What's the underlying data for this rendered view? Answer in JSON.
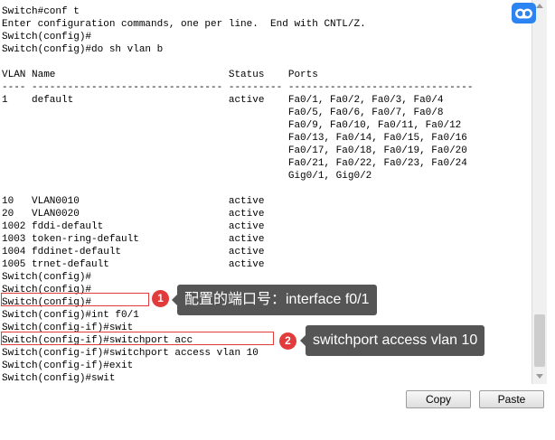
{
  "terminal": {
    "lines": [
      "Switch#conf t",
      "Enter configuration commands, one per line.  End with CNTL/Z.",
      "Switch(config)#",
      "Switch(config)#do sh vlan b",
      "",
      "VLAN Name                             Status    Ports",
      "---- -------------------------------- --------- -------------------------------",
      "1    default                          active    Fa0/1, Fa0/2, Fa0/3, Fa0/4",
      "                                                Fa0/5, Fa0/6, Fa0/7, Fa0/8",
      "                                                Fa0/9, Fa0/10, Fa0/11, Fa0/12",
      "                                                Fa0/13, Fa0/14, Fa0/15, Fa0/16",
      "                                                Fa0/17, Fa0/18, Fa0/19, Fa0/20",
      "                                                Fa0/21, Fa0/22, Fa0/23, Fa0/24",
      "                                                Gig0/1, Gig0/2",
      "",
      "10   VLAN0010                         active",
      "20   VLAN0020                         active",
      "1002 fddi-default                     active",
      "1003 token-ring-default               active",
      "1004 fddinet-default                  active",
      "1005 trnet-default                    active",
      "Switch(config)#",
      "Switch(config)#",
      "Switch(config)#",
      "Switch(config)#int f0/1",
      "Switch(config-if)#swit",
      "Switch(config-if)#switchport acc",
      "Switch(config-if)#switchport access vlan 10",
      "Switch(config-if)#exit",
      "Switch(config)#swit",
      "Switch(config)#"
    ]
  },
  "annotations": [
    {
      "number": "1",
      "text": "配置的端口号：interface f0/1"
    },
    {
      "number": "2",
      "text": "switchport access vlan 10"
    }
  ],
  "buttons": {
    "copy_label": "Copy",
    "paste_label": "Paste"
  },
  "colors": {
    "annotation_red": "#e23b3b",
    "callout_bg": "#555555",
    "icon_blue": "#2b84f2"
  },
  "icons": {
    "top_right": "baidu-netdisk-cloud-icon"
  }
}
